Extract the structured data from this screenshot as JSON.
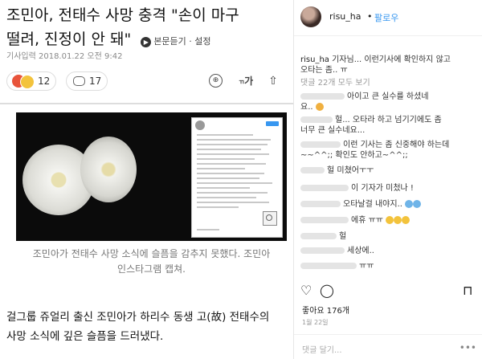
{
  "article": {
    "headline_line1": "조민아, 전태수 사망 충격 \"손이 마구",
    "headline_line2": "떨려, 진정이 안 돼\"",
    "listen_label": "본문듣기",
    "settings_label": "설정",
    "meta": "기사입력 2018.01.22 오전 9:42",
    "reaction_count": "12",
    "comment_count": "17",
    "font_button": "가",
    "caption_line1": "조민아가 전태수 사망 소식에 슬픔을 감추지 못했다. 조민아",
    "caption_line2": "인스타그램 캡쳐.",
    "body_line1": "걸그룹 쥬얼리 출신 조민아가 하리수 동생 고(故) 전태수의",
    "body_line2": "사망 소식에 깊은 슬픔을 드러냈다."
  },
  "instagram": {
    "username": "risu_ha",
    "dot": "•",
    "follow": "팔로우",
    "caption_user": "risu_ha",
    "caption_text1": "기자님... 이런기사에 확인하지 않고",
    "caption_text2": "오타는 좀.. ㅠ",
    "view_more": "댓글 22개 모두 보기",
    "comments": [
      "아이고 큰 실수를 하셨네",
      "요..",
      "헐... 오타라 하고 넘기기에도 좀",
      "너무 큰 실수네요...",
      "이런 기사는 좀 신중해야 하는데",
      "~~^^;; 확인도 안하고~^^;;",
      "헐 미쳤어ㅜㅜ",
      "이 기자가 미첬나 !",
      "오타날걸 내야지..",
      "에휴 ㅠㅠ",
      "헐",
      "세상에..",
      "ㅠㅠ"
    ],
    "likes": "좋아요 176개",
    "date": "1월 22일",
    "add_comment": "댓글 달기...",
    "more_icon": "•••"
  }
}
